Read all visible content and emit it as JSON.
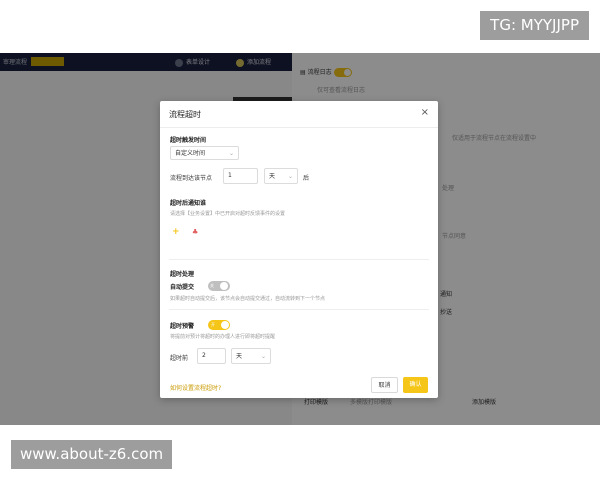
{
  "watermarks": {
    "top": "TG: MYYJJPP",
    "bottom": "www.about-z6.com"
  },
  "background": {
    "topbar": {
      "title": "审理流程",
      "tag": "",
      "nav_form": "表单设计",
      "nav_process": "添加流程"
    },
    "panel": {
      "log_label": "流程日志",
      "log_desc": "仅可查看流程日志",
      "desc_line": "仅适用于流程节点在流程设置中",
      "item_handle": "处理",
      "item_reach": "节点同意",
      "item_notify": "通知",
      "item_cc": "抄送",
      "print_label": "打印模版",
      "print_desc": "多模版打印模版",
      "add_template": "添加模版"
    }
  },
  "modal": {
    "title": "流程超时",
    "close_icon": "×",
    "trigger": {
      "heading": "超时触发时间",
      "select_value": "自定义时间",
      "reach_label": "流程到达该节点",
      "amount_value": "1",
      "unit_value": "天",
      "after_label": "后"
    },
    "notify": {
      "heading": "超时后通知谁",
      "hint": "请选择【业务设置】中已开启对超时反馈事件的设置"
    },
    "handle": {
      "heading": "超时处理",
      "auto_submit_label": "自动提交",
      "auto_submit_state": "关",
      "hint": "如果超时自动提交后，该节点会自动提交通过，自动流转到下一个节点"
    },
    "warn": {
      "heading": "超时预警",
      "toggle_state": "开",
      "hint": "将提前对预计将超时的办理人进行即将超时提醒",
      "before_label": "超时前",
      "amount_value": "2",
      "unit_value": "天"
    },
    "footer": {
      "help_link": "如何设置流程超时?",
      "cancel_label": "取消",
      "ok_label": "确认"
    }
  }
}
